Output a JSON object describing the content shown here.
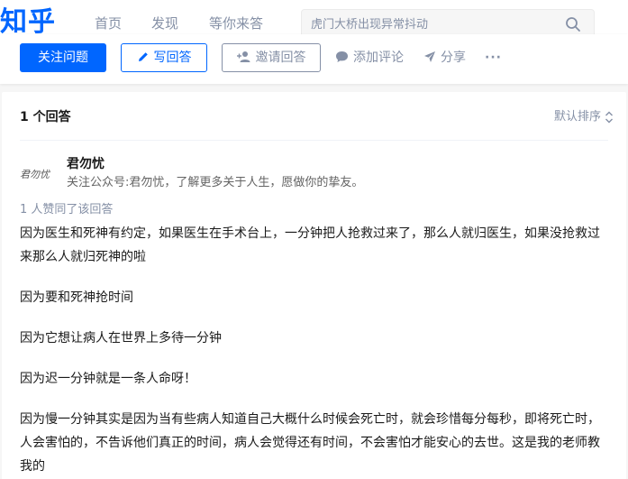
{
  "header": {
    "logo": "知乎",
    "nav": [
      "首页",
      "发现",
      "等你来答"
    ],
    "search_placeholder": "虎门大桥出现异常抖动"
  },
  "actions": {
    "follow_question": "关注问题",
    "write_answer": "写回答",
    "invite_answer": "邀请回答",
    "add_comment": "添加评论",
    "share": "分享",
    "more": "···"
  },
  "answers": {
    "count_label": "1 个回答",
    "sort_label": "默认排序"
  },
  "answer": {
    "avatar_text": "君勿忧",
    "author_name": "君勿忧",
    "author_bio": "关注公众号:君勿忧，了解更多关于人生，愿做你的挚友。",
    "votes_label": "1 人赞同了该回答",
    "paragraphs": [
      "因为医生和死神有约定，如果医生在手术台上，一分钟把人抢救过来了，那么人就归医生，如果没抢救过来那么人就归死神的啦",
      "因为要和死神抢时间",
      "因为它想让病人在世界上多待一分钟",
      "因为迟一分钟就是一条人命呀！",
      "因为慢一分钟其实是因为当有些病人知道自己大概什么时候会死亡时，就会珍惜每分每秒，即将死亡时，人会害怕的，不告诉他们真正的时间，病人会觉得还有时间，不会害怕才能安心的去世。这是我的老师教我的"
    ]
  },
  "colors": {
    "brand": "#0066ff",
    "muted": "#8590a6",
    "background": "#f6f6f6"
  }
}
